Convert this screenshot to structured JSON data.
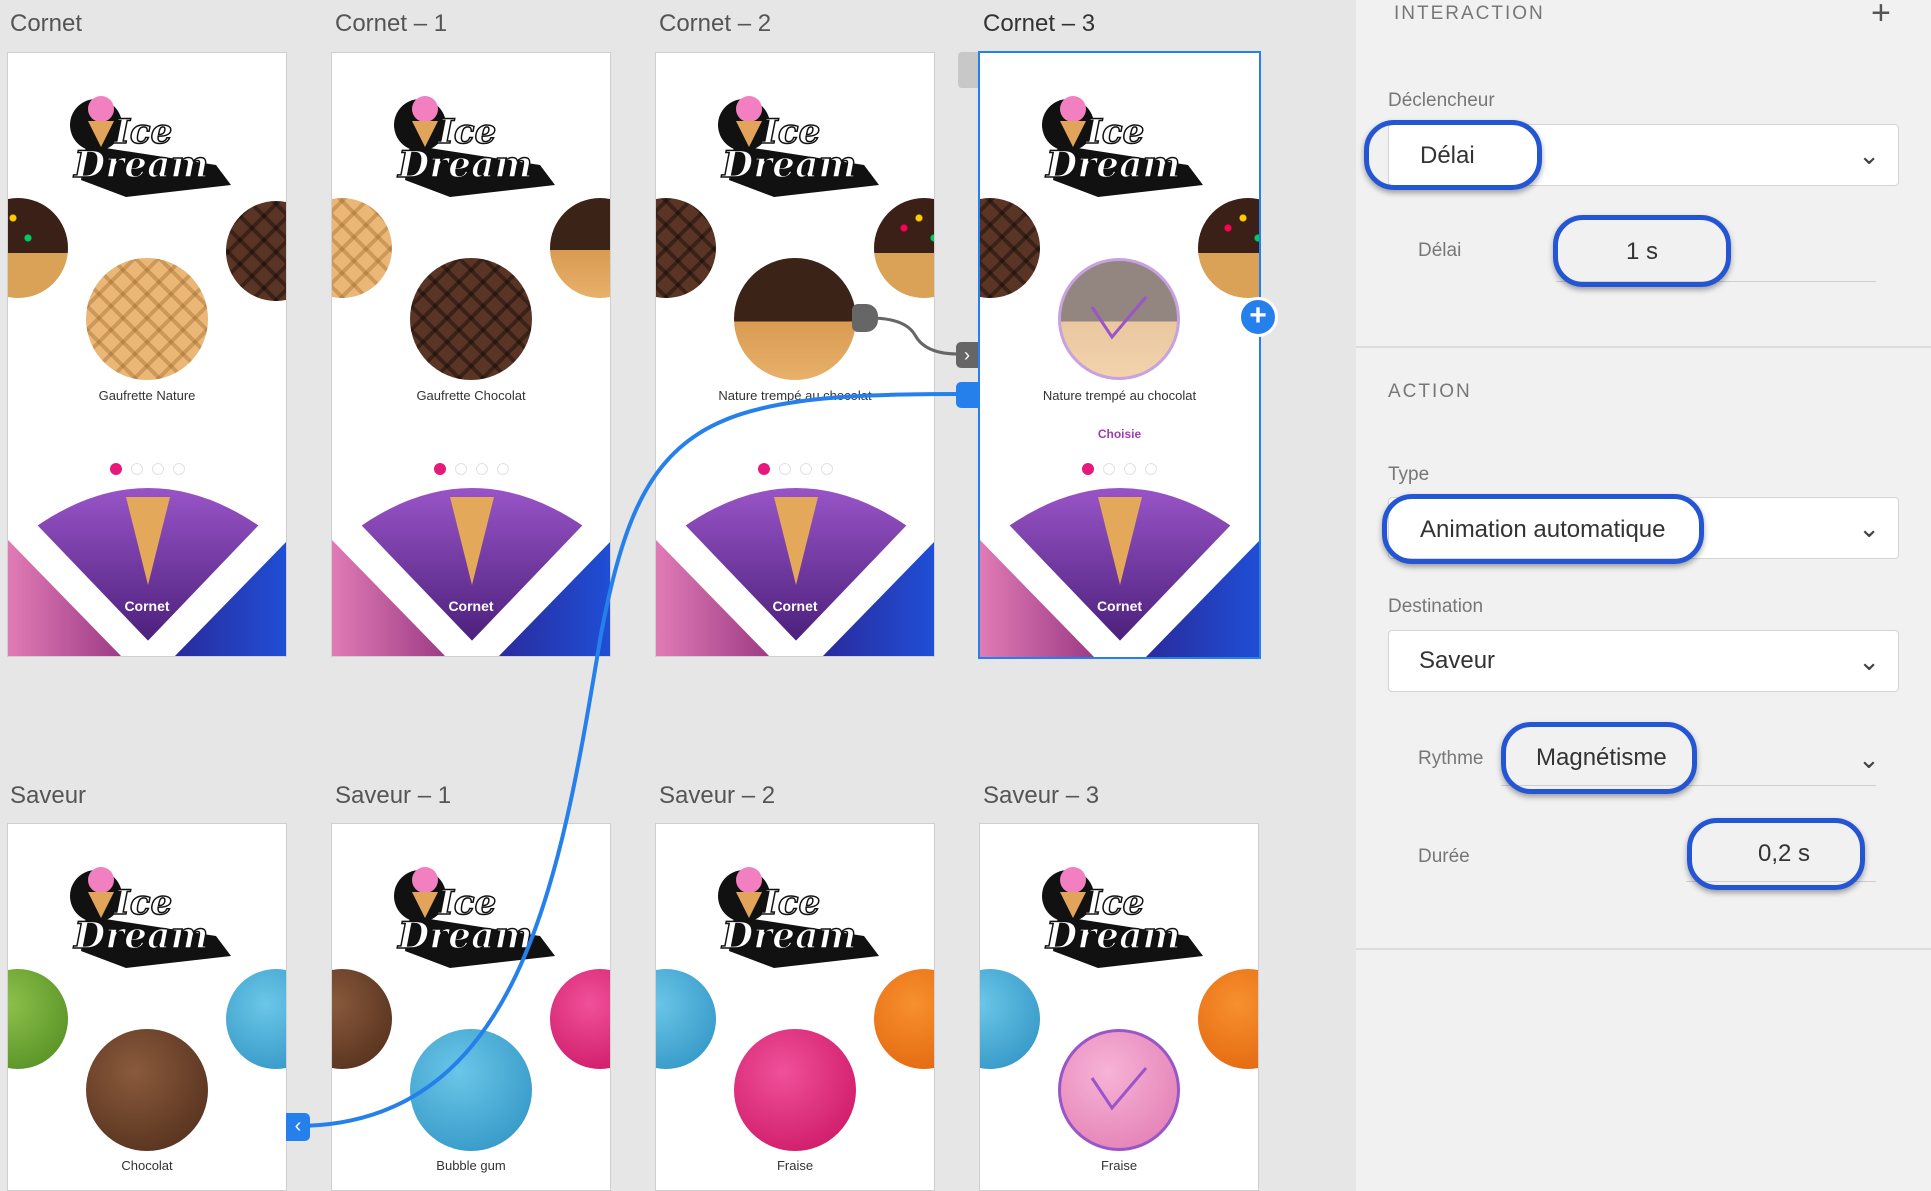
{
  "artboards": {
    "cornet": [
      {
        "label": "Cornet",
        "caption": "Gaufrette Nature",
        "fan_label": "Cornet"
      },
      {
        "label": "Cornet – 1",
        "caption": "Gaufrette Chocolat",
        "fan_label": "Cornet"
      },
      {
        "label": "Cornet – 2",
        "caption": "Nature trempé au chocolat",
        "fan_label": "Cornet"
      },
      {
        "label": "Cornet – 3",
        "caption": "Nature trempé au chocolat",
        "chosen": "Choisie",
        "fan_label": "Cornet"
      }
    ],
    "saveur": [
      {
        "label": "Saveur",
        "caption": "Chocolat"
      },
      {
        "label": "Saveur – 1",
        "caption": "Bubble gum"
      },
      {
        "label": "Saveur – 2",
        "caption": "Fraise"
      },
      {
        "label": "Saveur – 3",
        "caption": "Fraise"
      }
    ],
    "logo_text": [
      "Ice",
      "Dream"
    ]
  },
  "panel": {
    "interaction_title": "INTERACTION",
    "add_icon": "+",
    "trigger_label": "Déclencheur",
    "trigger_value": "Délai",
    "delay_label": "Délai",
    "delay_value": "1 s",
    "action_title": "ACTION",
    "type_label": "Type",
    "type_value": "Animation automatique",
    "destination_label": "Destination",
    "destination_value": "Saveur",
    "easing_label": "Rythme",
    "easing_value": "Magnétisme",
    "duration_label": "Durée",
    "duration_value": "0,2 s"
  },
  "colors": {
    "accent": "#2680eb",
    "highlight": "#2456d3",
    "dot_active": "#e6197c",
    "fan_purple": "#7b3fb5",
    "chosen": "#9b3fb0"
  },
  "icons": [
    "chevron-down-icon",
    "plus-icon",
    "chevron-right-icon",
    "chevron-left-icon",
    "checkmark-icon"
  ]
}
